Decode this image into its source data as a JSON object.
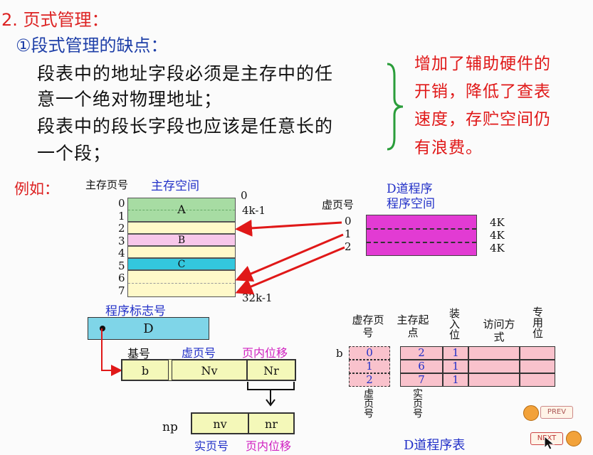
{
  "heading": "2. 页式管理：",
  "subheading": "①段式管理的缺点：",
  "para": [
    "段表中的地址字段必须是主存中的任",
    "意一个绝对物理地址；",
    "段表中的段长字段也应该是任意长的",
    "一个段；"
  ],
  "note": [
    "增加了辅助硬件的",
    "开销，降低了查表",
    "速度，存贮空间仍",
    "有浪费。"
  ],
  "example_label": "例如：",
  "memory": {
    "page_no_label": "主存页号",
    "space_label": "主存空间",
    "row_numbers": [
      "0",
      "1",
      "2",
      "3",
      "4",
      "5",
      "6",
      "7"
    ],
    "blocks": [
      "A",
      "B",
      "C"
    ],
    "addr_top": "0",
    "addr_4k": "4k-1",
    "addr_end": "32k-1"
  },
  "program": {
    "title1": "D道程序",
    "title2": "程序空间",
    "vpage_label": "虚页号",
    "vpages": [
      "0",
      "1",
      "2"
    ],
    "sizes": [
      "4K",
      "4K",
      "4K"
    ]
  },
  "address": {
    "flag_label": "程序标志号",
    "flag_value": "D",
    "base_label": "基号",
    "vpage_label": "虚页号",
    "offset_label": "页内位移",
    "b": "b",
    "nv_cap": "Nv",
    "nr_cap": "Nr",
    "np": "np",
    "nv": "nv",
    "nr": "nr",
    "real_label": "实页号",
    "real_offset_label": "页内位移"
  },
  "table": {
    "headers": [
      "虚存页号",
      "主存起点",
      "装入位",
      "访问方式",
      "专用位"
    ],
    "b": "b",
    "rows": [
      [
        "0",
        "2",
        "1"
      ],
      [
        "1",
        "6",
        "1"
      ],
      [
        "2",
        "7",
        "1"
      ]
    ],
    "bottom_vpage": "虚页号",
    "bottom_real": "实页号",
    "caption": "D道程序表"
  },
  "nav": {
    "prev": "PREV",
    "next": "NEXT"
  }
}
